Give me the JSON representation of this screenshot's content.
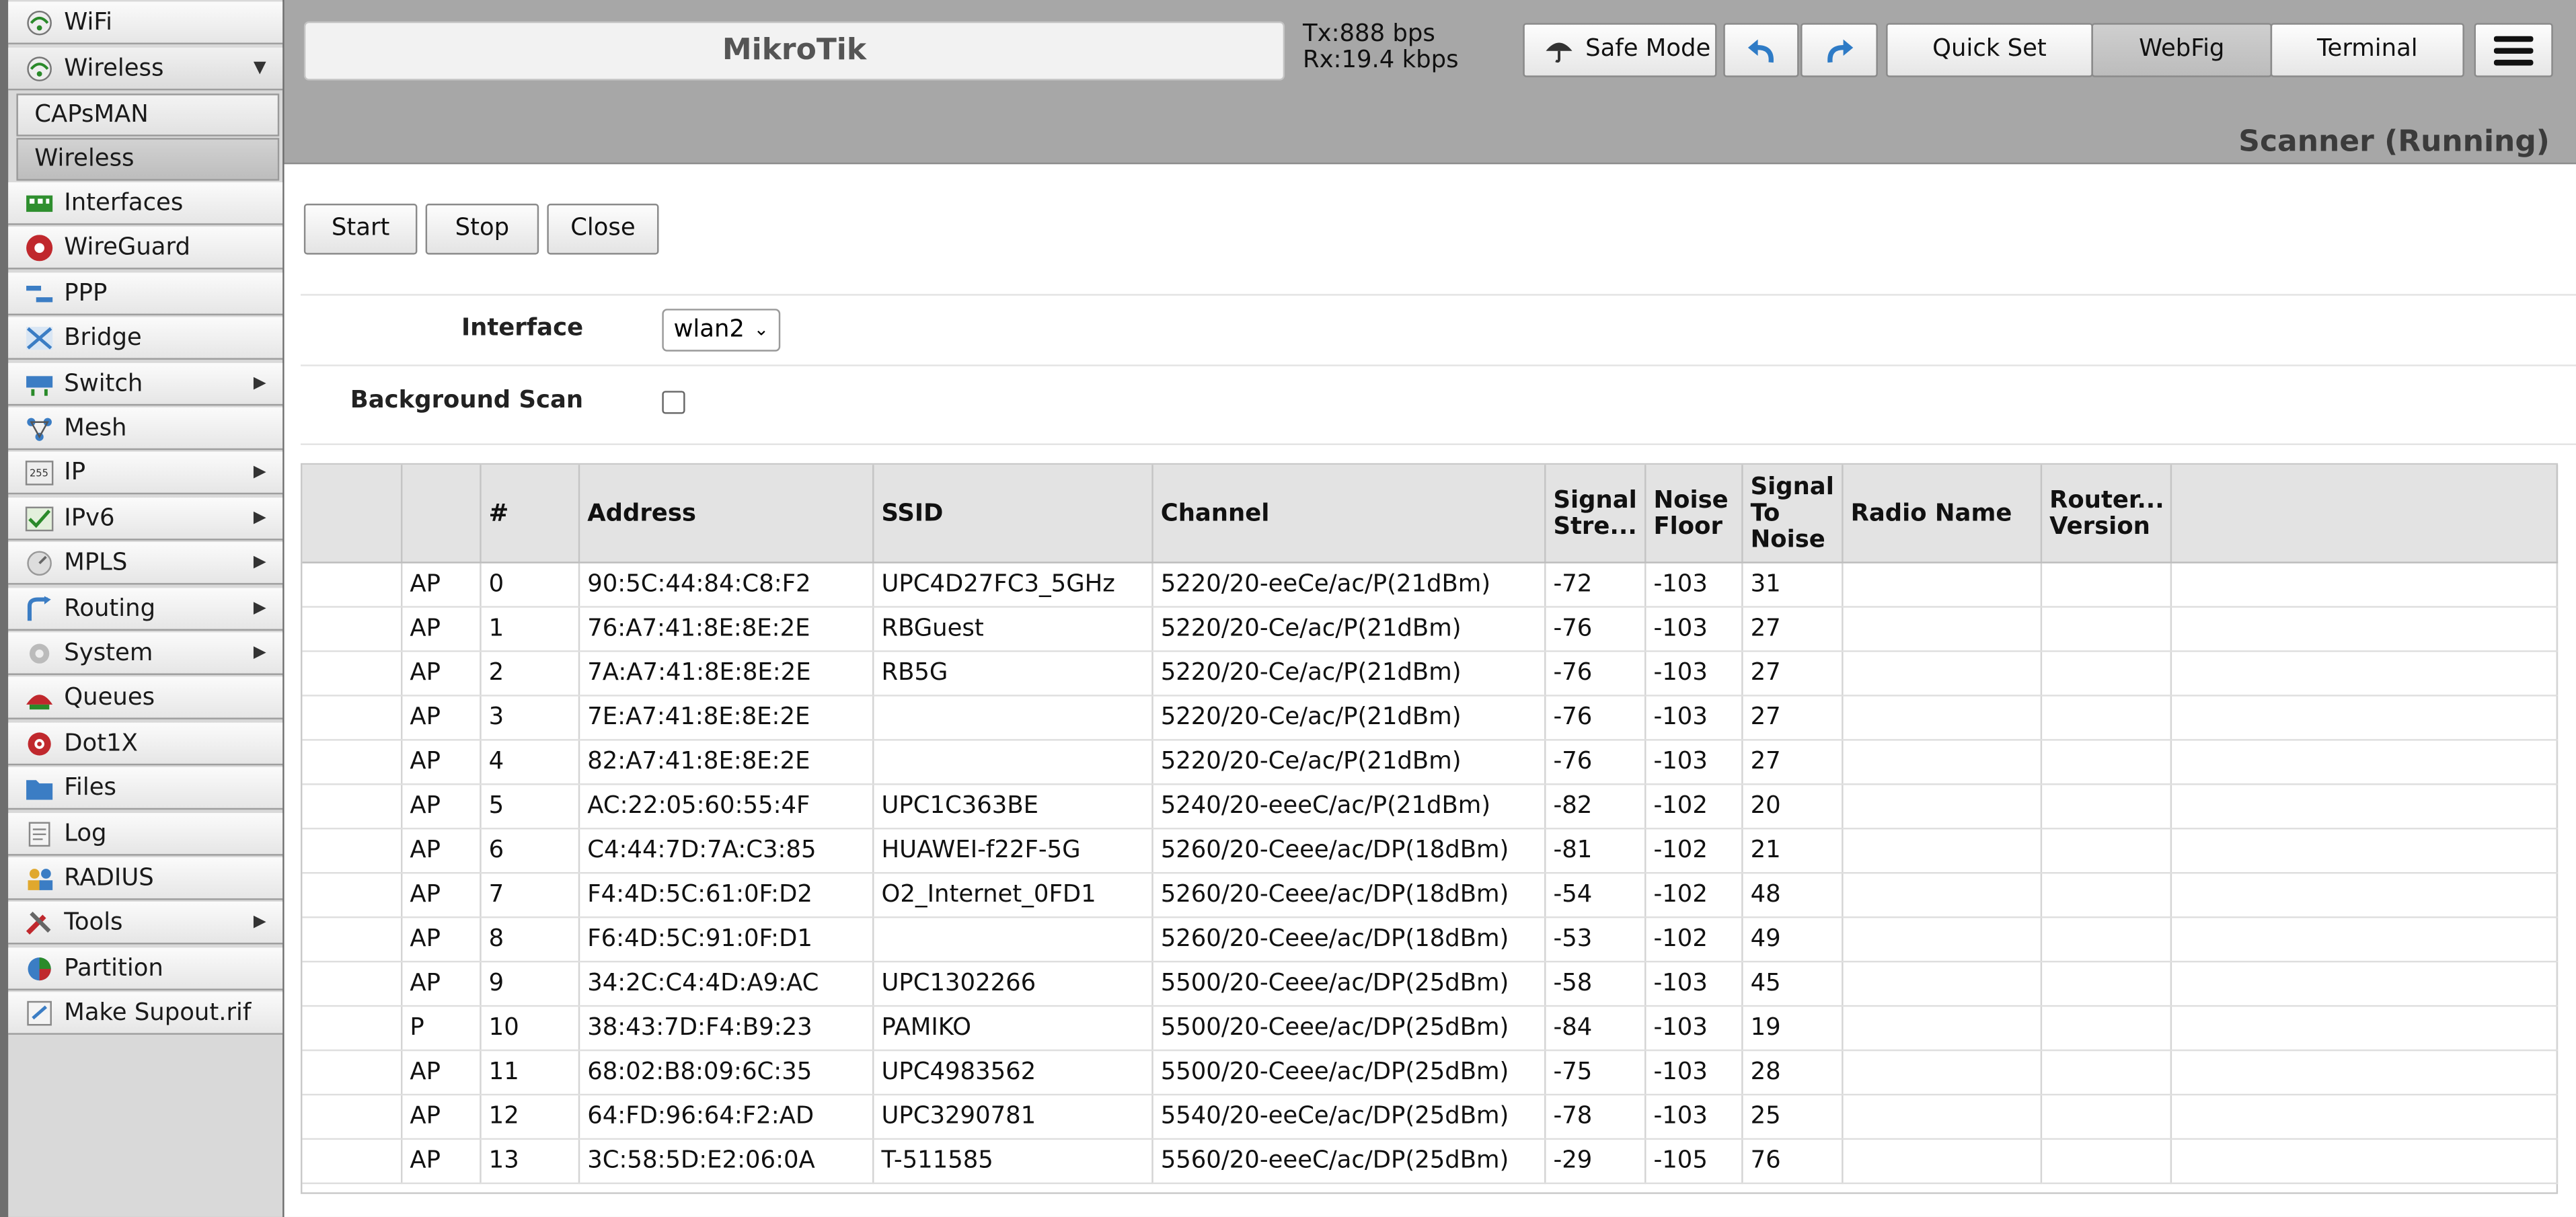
{
  "sidebar": {
    "items": [
      {
        "label": "WiFi",
        "icon": "wifi-icon"
      },
      {
        "label": "Wireless",
        "icon": "wireless-icon",
        "arrow": "▼"
      },
      {
        "label": "Interfaces",
        "icon": "interfaces-icon"
      },
      {
        "label": "WireGuard",
        "icon": "wireguard-icon"
      },
      {
        "label": "PPP",
        "icon": "ppp-icon"
      },
      {
        "label": "Bridge",
        "icon": "bridge-icon"
      },
      {
        "label": "Switch",
        "icon": "switch-icon",
        "arrow": "▶"
      },
      {
        "label": "Mesh",
        "icon": "mesh-icon"
      },
      {
        "label": "IP",
        "icon": "ip-icon",
        "arrow": "▶"
      },
      {
        "label": "IPv6",
        "icon": "ipv6-icon",
        "arrow": "▶"
      },
      {
        "label": "MPLS",
        "icon": "mpls-icon",
        "arrow": "▶"
      },
      {
        "label": "Routing",
        "icon": "routing-icon",
        "arrow": "▶"
      },
      {
        "label": "System",
        "icon": "system-icon",
        "arrow": "▶"
      },
      {
        "label": "Queues",
        "icon": "queues-icon"
      },
      {
        "label": "Dot1X",
        "icon": "dot1x-icon"
      },
      {
        "label": "Files",
        "icon": "files-icon"
      },
      {
        "label": "Log",
        "icon": "log-icon"
      },
      {
        "label": "RADIUS",
        "icon": "radius-icon"
      },
      {
        "label": "Tools",
        "icon": "tools-icon",
        "arrow": "▶"
      },
      {
        "label": "Partition",
        "icon": "partition-icon"
      },
      {
        "label": "Make Supout.rif",
        "icon": "supout-icon"
      }
    ],
    "submenu": [
      {
        "label": "CAPsMAN"
      },
      {
        "label": "Wireless"
      }
    ]
  },
  "header": {
    "title": "MikroTik",
    "tx": "Tx:888 bps",
    "rx": "Rx:19.4 kbps",
    "safe_mode": "Safe Mode",
    "quick_set": "Quick Set",
    "webfig": "WebFig",
    "terminal": "Terminal",
    "page_title": "Scanner (Running)"
  },
  "actions": {
    "start": "Start",
    "stop": "Stop",
    "close": "Close"
  },
  "form": {
    "interface_label": "Interface",
    "interface_value": "wlan2",
    "bgscan_label": "Background Scan"
  },
  "table": {
    "columns": [
      "",
      "",
      "#",
      "Address",
      "SSID",
      "Channel",
      "Signal Stre...",
      "Noise Floor",
      "Signal To Noise",
      "Radio Name",
      "Router... Version",
      ""
    ],
    "rows": [
      [
        "",
        "AP",
        "0",
        "90:5C:44:84:C8:F2",
        "UPC4D27FC3_5GHz",
        "5220/20-eeCe/ac/P(21dBm)",
        "-72",
        "-103",
        "31",
        "",
        "",
        ""
      ],
      [
        "",
        "AP",
        "1",
        "76:A7:41:8E:8E:2E",
        "RBGuest",
        "5220/20-Ce/ac/P(21dBm)",
        "-76",
        "-103",
        "27",
        "",
        "",
        ""
      ],
      [
        "",
        "AP",
        "2",
        "7A:A7:41:8E:8E:2E",
        "RB5G",
        "5220/20-Ce/ac/P(21dBm)",
        "-76",
        "-103",
        "27",
        "",
        "",
        ""
      ],
      [
        "",
        "AP",
        "3",
        "7E:A7:41:8E:8E:2E",
        "",
        "5220/20-Ce/ac/P(21dBm)",
        "-76",
        "-103",
        "27",
        "",
        "",
        ""
      ],
      [
        "",
        "AP",
        "4",
        "82:A7:41:8E:8E:2E",
        "",
        "5220/20-Ce/ac/P(21dBm)",
        "-76",
        "-103",
        "27",
        "",
        "",
        ""
      ],
      [
        "",
        "AP",
        "5",
        "AC:22:05:60:55:4F",
        "UPC1C363BE",
        "5240/20-eeeC/ac/P(21dBm)",
        "-82",
        "-102",
        "20",
        "",
        "",
        ""
      ],
      [
        "",
        "AP",
        "6",
        "C4:44:7D:7A:C3:85",
        "HUAWEI-f22F-5G",
        "5260/20-Ceee/ac/DP(18dBm)",
        "-81",
        "-102",
        "21",
        "",
        "",
        ""
      ],
      [
        "",
        "AP",
        "7",
        "F4:4D:5C:61:0F:D2",
        "O2_Internet_0FD1",
        "5260/20-Ceee/ac/DP(18dBm)",
        "-54",
        "-102",
        "48",
        "",
        "",
        ""
      ],
      [
        "",
        "AP",
        "8",
        "F6:4D:5C:91:0F:D1",
        "",
        "5260/20-Ceee/ac/DP(18dBm)",
        "-53",
        "-102",
        "49",
        "",
        "",
        ""
      ],
      [
        "",
        "AP",
        "9",
        "34:2C:C4:4D:A9:AC",
        "UPC1302266",
        "5500/20-Ceee/ac/DP(25dBm)",
        "-58",
        "-103",
        "45",
        "",
        "",
        ""
      ],
      [
        "",
        "P",
        "10",
        "38:43:7D:F4:B9:23",
        "PAMIKO",
        "5500/20-Ceee/ac/DP(25dBm)",
        "-84",
        "-103",
        "19",
        "",
        "",
        ""
      ],
      [
        "",
        "AP",
        "11",
        "68:02:B8:09:6C:35",
        "UPC4983562",
        "5500/20-Ceee/ac/DP(25dBm)",
        "-75",
        "-103",
        "28",
        "",
        "",
        ""
      ],
      [
        "",
        "AP",
        "12",
        "64:FD:96:64:F2:AD",
        "UPC3290781",
        "5540/20-eeCe/ac/DP(25dBm)",
        "-78",
        "-103",
        "25",
        "",
        "",
        ""
      ],
      [
        "",
        "AP",
        "13",
        "3C:58:5D:E2:06:0A",
        "T-511585",
        "5560/20-eeeC/ac/DP(25dBm)",
        "-29",
        "-105",
        "76",
        "",
        "",
        ""
      ]
    ]
  },
  "colors": {
    "sidebar_bg": "#d9d9d9",
    "topbar_bg": "#a7a7a7",
    "accent_blue": "#2e7bc6"
  }
}
